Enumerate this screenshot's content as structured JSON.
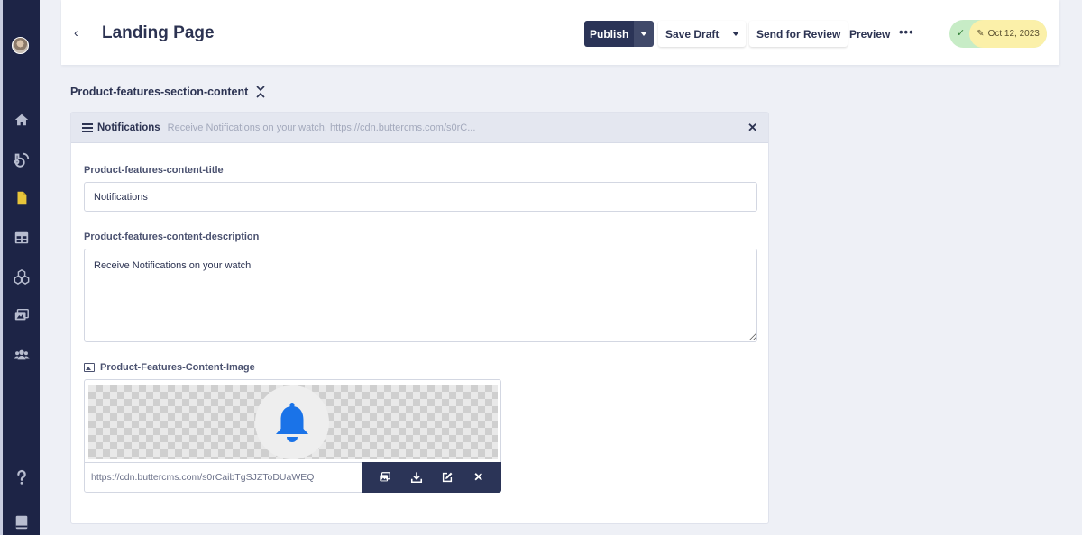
{
  "header": {
    "title": "Landing Page",
    "publish_label": "Publish",
    "save_draft_label": "Save Draft",
    "send_review_label": "Send for Review",
    "preview_label": "Preview",
    "more_label": "•••",
    "status_date": "Oct 12, 2023"
  },
  "section": {
    "title": "Product-features-section-content"
  },
  "card": {
    "name": "Notifications",
    "summary": "Receive Notifications on your watch, https://cdn.buttercms.com/s0rC...",
    "fields": {
      "title_label": "Product-features-content-title",
      "title_value": "Notifications",
      "description_label": "Product-features-content-description",
      "description_value": "Receive Notifications on your watch",
      "image_label": "Product-Features-Content-Image",
      "image_url": "https://cdn.buttercms.com/s0rCaibTgSJZToDUaWEQ"
    }
  },
  "sidebar": {
    "items": [
      {
        "icon": "home-icon"
      },
      {
        "icon": "blog-icon"
      },
      {
        "icon": "pages-icon",
        "active": true
      },
      {
        "icon": "collections-icon"
      },
      {
        "icon": "components-icon"
      },
      {
        "icon": "media-icon"
      },
      {
        "icon": "users-icon"
      },
      {
        "icon": "help-icon"
      },
      {
        "icon": "docs-icon"
      }
    ]
  },
  "colors": {
    "sidebar_bg": "#1d2446",
    "primary_dark": "#2b3457",
    "bell_blue": "#1a73e8",
    "status_green": "#c7ecc6",
    "status_yellow": "#fbf0a9",
    "active_icon": "#e8c53a"
  }
}
